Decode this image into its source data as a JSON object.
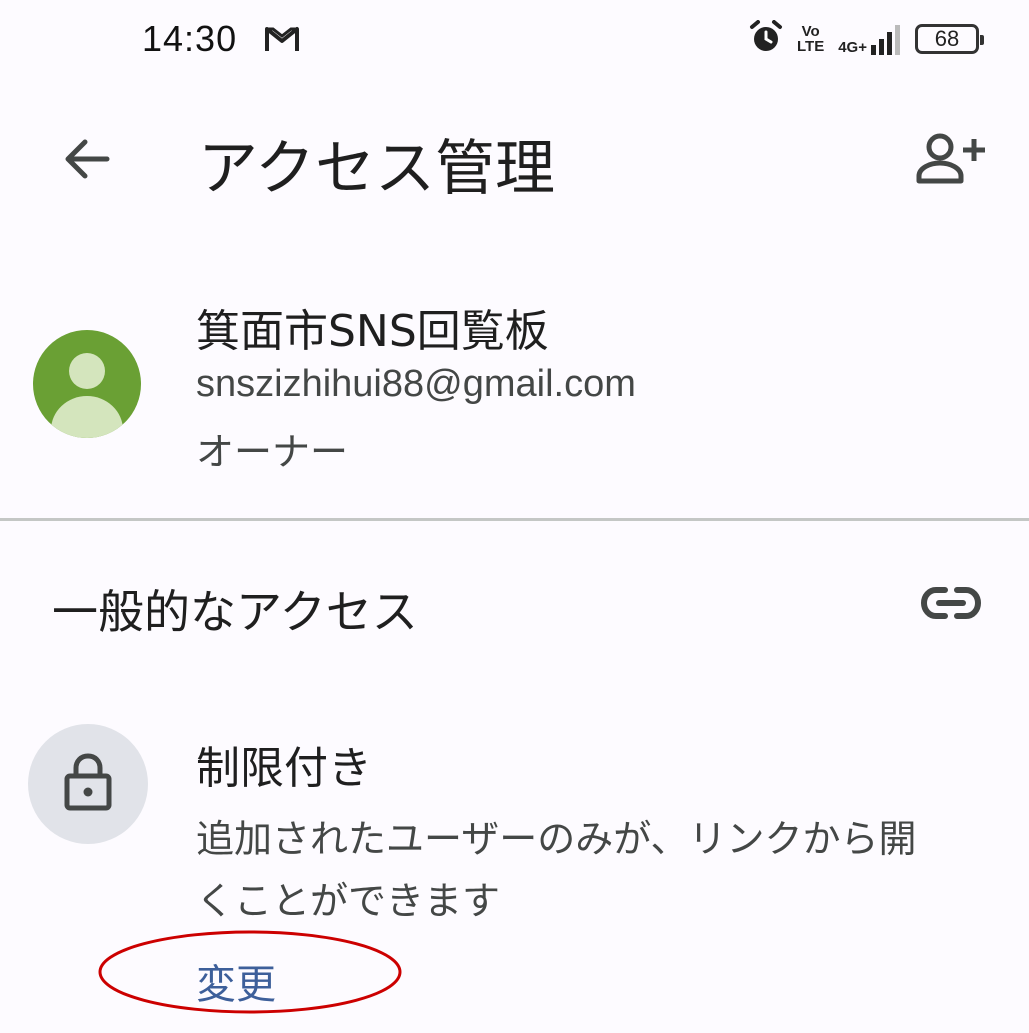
{
  "status_bar": {
    "time": "14:30",
    "network": "4G+",
    "volte_top": "Vo",
    "volte_bottom": "LTE",
    "battery": "68"
  },
  "app_bar": {
    "title": "アクセス管理"
  },
  "owner": {
    "name": "箕面市SNS回覧板",
    "email": "snszizhihui88@gmail.com",
    "role": "オーナー",
    "avatar_color": "#6aa034"
  },
  "general_access": {
    "section_title": "一般的なアクセス",
    "level_title": "制限付き",
    "level_description": "追加されたユーザーのみが、リンクから開くことができます",
    "change_label": "変更"
  },
  "colors": {
    "background": "#fdfbff",
    "link": "#3d5f9a",
    "annotation": "#cc0000",
    "divider": "#c4c7c5"
  }
}
